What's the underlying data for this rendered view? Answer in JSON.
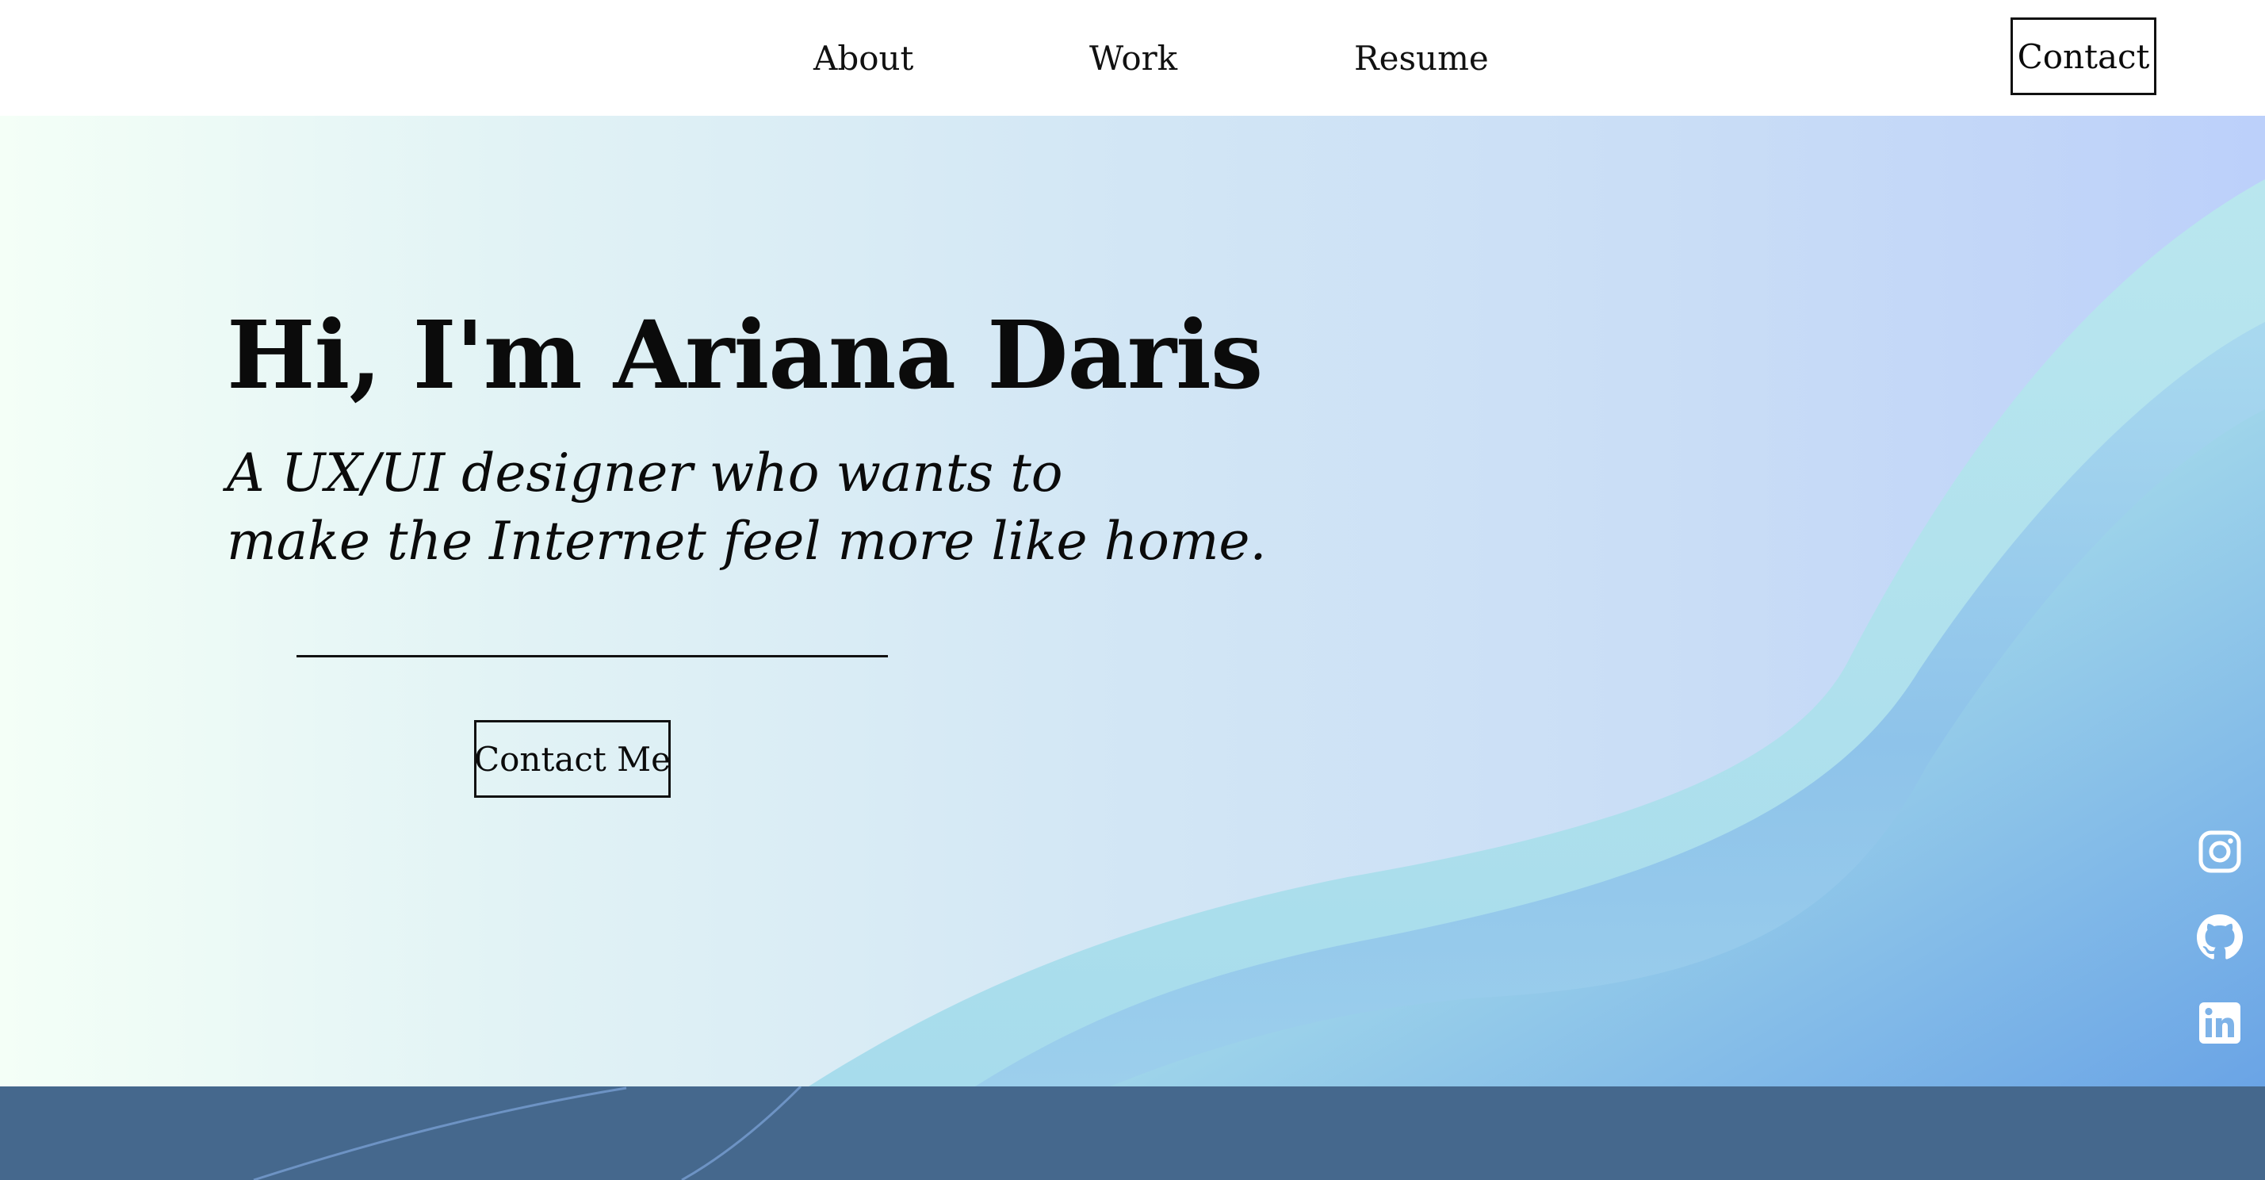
{
  "nav": {
    "items": [
      {
        "label": "About"
      },
      {
        "label": "Work"
      },
      {
        "label": "Resume"
      }
    ],
    "contact_label": "Contact"
  },
  "hero": {
    "title": "Hi, I'm Ariana Daris",
    "subtitle_lines": [
      "A UX/UI designer who wants to",
      "make the Internet feel more like home."
    ],
    "cta_label": "Contact Me"
  },
  "social": {
    "icons": [
      "instagram-icon",
      "github-icon",
      "linkedin-icon"
    ]
  },
  "colors": {
    "background_start": "#f4fff7",
    "background_end": "#bcd0fa",
    "wave_light": "#b5e4ef",
    "wave_mid": "#92c6ea",
    "wave_dark": "#6fa5e6",
    "footer_band": "#45688d",
    "text": "#0b0b0b"
  }
}
